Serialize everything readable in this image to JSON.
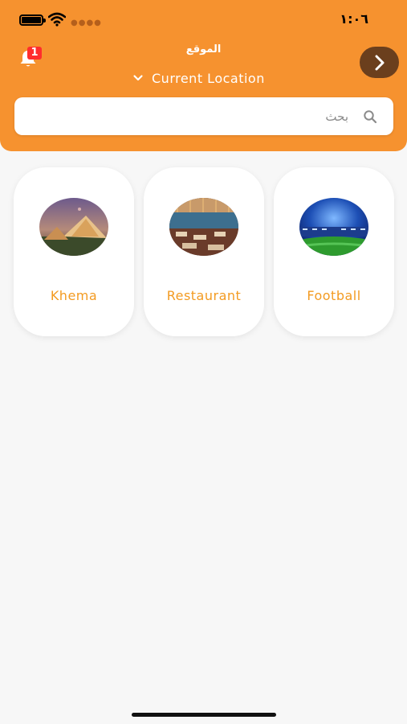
{
  "status_bar": {
    "time": "١:٠٦",
    "signal_dots": "●●●●"
  },
  "header": {
    "notification_count": "1",
    "location_label": "الموقع",
    "location_value": "Current Location",
    "search": {
      "placeholder": "بحث",
      "value": ""
    }
  },
  "categories": [
    {
      "label": "Khema"
    },
    {
      "label": "Restaurant"
    },
    {
      "label": "Football"
    }
  ],
  "colors": {
    "header_bg": "#f6922f",
    "accent_text": "#f39b22",
    "forward_button": "#6b3f1d",
    "badge": "#ff2d2d",
    "page_bg": "#f7f7f7"
  },
  "icons": [
    "battery-icon",
    "wifi-icon",
    "bell-icon",
    "chevron-down-icon",
    "chevron-right-icon",
    "search-icon"
  ]
}
